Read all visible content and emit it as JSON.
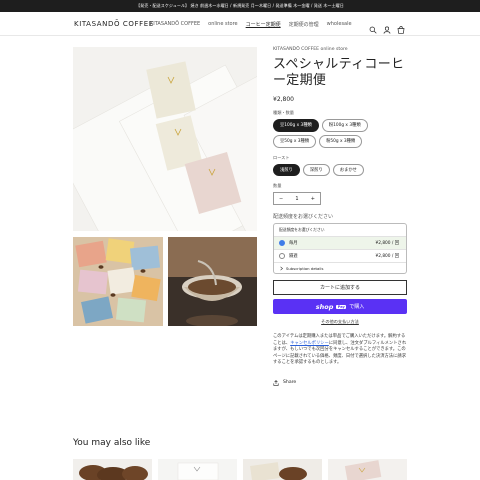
{
  "announcement": "【発売・配送スケジュール】 焼き 前週木〜水曜日 / 新規発売 月〜木曜日 / 発送準備 木〜金曜 / 発送 木〜土曜日",
  "header": {
    "logo": "KITASANDŌ COFFEE",
    "nav": [
      "KITASANDŌ COFFEE",
      "online store",
      "コーヒー定期便",
      "定期便の管理",
      "wholesale"
    ]
  },
  "product": {
    "vendor": "KITASANDŌ COFFEE online store",
    "title": "スペシャルティコーヒー定期便",
    "price": "¥2,800",
    "type_label": "種類・数量",
    "type_options": [
      "豆100g x 3種類",
      "粉100g x 3種類",
      "豆50g x 3種類",
      "粉50g x 3種類"
    ],
    "type_selected": 0,
    "roast_label": "ロースト",
    "roast_options": [
      "浅煎り",
      "深煎り",
      "おまかせ"
    ],
    "roast_selected": 0,
    "qty_label": "数量",
    "qty": {
      "minus": "−",
      "value": "1",
      "plus": "+"
    }
  },
  "subscription": {
    "label": "配送頻度をお選びください",
    "box_title": "配送頻度をお選びください",
    "options": [
      {
        "name": "毎月",
        "price": "¥2,800 / 回"
      },
      {
        "name": "隔週",
        "price": "¥2,800 / 回"
      }
    ],
    "details": "Subscription details"
  },
  "buttons": {
    "add_to_cart": "カートに追加する",
    "shop_logo": "shop",
    "pay_badge": "Pay",
    "buy": "で購入",
    "more_payment": "その他の支払い方法"
  },
  "description": {
    "before": "このアイテムは定期購入または単品でご購入いただけます。解約することは、",
    "link": "キャンセルポリシー",
    "after": "に同意し、注文ダブルフィルメントされますが、もしいつでも次回分をキャンセルすることができます。このページに記載されている価格、頻度、日付で選択した決済方法に請求することを承認するものとします。"
  },
  "share": "Share",
  "recommend_title": "You may also like",
  "colors": {
    "shop_pay": "#5a31f4",
    "selected": "#1e1e1e",
    "radio": "#3f7de8"
  }
}
